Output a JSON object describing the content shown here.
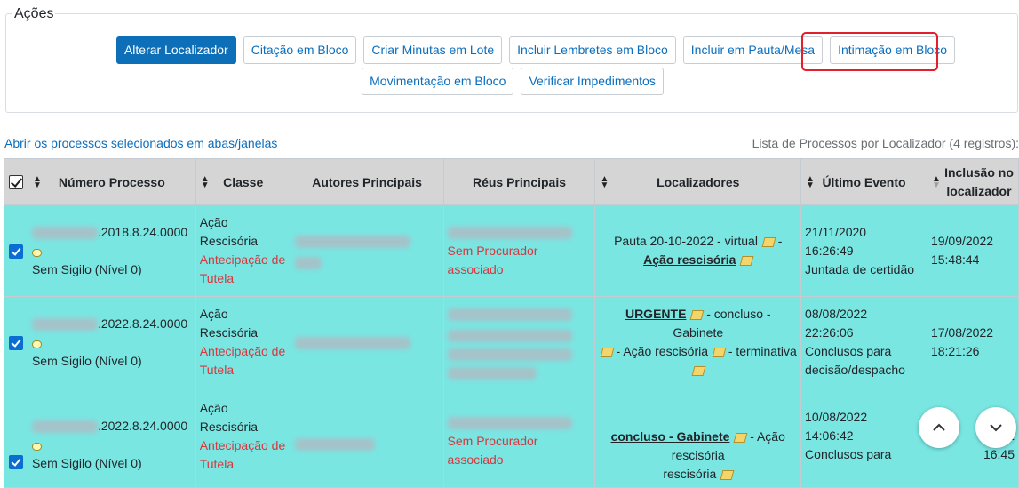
{
  "acoes": {
    "legend": "Ações",
    "buttons_row1": [
      "Alterar Localizador",
      "Citação em Bloco",
      "Criar Minutas em Lote",
      "Incluir Lembretes em Bloco",
      "Incluir em Pauta/Mesa",
      "Intimação em Bloco"
    ],
    "buttons_row2": [
      "Movimentação em Bloco",
      "Verificar Impedimentos"
    ]
  },
  "links": {
    "abrir": "Abrir os processos selecionados em abas/janelas",
    "lista_caption": "Lista de Processos por Localizador (4 registros):"
  },
  "table": {
    "headers": [
      "Número Processo",
      "Classe",
      "Autores Principais",
      "Réus Principais",
      "Localizadores",
      "Último Evento",
      "Inclusão no localizador"
    ],
    "rows": [
      {
        "numero": ".2018.8.24.0000",
        "sigilo": "Sem Sigilo (Nível 0)",
        "classe": "Ação Rescisória",
        "classe_extra": "Antecipação de Tutela",
        "reu_extra": "Sem Procurador associado",
        "loc_prefix": "Pauta 20-10-2022 - virtual",
        "loc_link": "Ação rescisória",
        "evento_data": "21/11/2020",
        "evento_hora": "16:26:49",
        "evento_desc": "Juntada de certidão",
        "inclusao_data": "19/09/2022",
        "inclusao_hora": "15:48:44"
      },
      {
        "numero": ".2022.8.24.0000",
        "sigilo": "Sem Sigilo (Nível 0)",
        "classe": "Ação Rescisória",
        "classe_extra": "Antecipação de Tutela",
        "loc_link": "URGENTE",
        "loc_mid": "- concluso - Gabinete",
        "loc_mid2": "- Ação rescisória",
        "loc_end": "- terminativa",
        "evento_data": "08/08/2022",
        "evento_hora": "22:26:06",
        "evento_desc": "Conclusos para decisão/despacho",
        "inclusao_data": "17/08/2022",
        "inclusao_hora": "18:21:26"
      },
      {
        "numero": ".2022.8.24.0000",
        "sigilo": "Sem Sigilo (Nível 0)",
        "classe": "Ação Rescisória",
        "classe_extra": "Antecipação de Tutela",
        "reu_extra": "Sem Procurador associado",
        "loc_link": "concluso - Gabinete",
        "loc_mid": "- Ação rescisória",
        "evento_data": "10/08/2022",
        "evento_hora": "14:06:42",
        "evento_desc": "Conclusos para",
        "inclusao_data": "/2",
        "inclusao_hora": "16:45"
      }
    ]
  },
  "icons": {
    "scroll_up": "chevron-up-icon",
    "scroll_down": "chevron-down-icon"
  }
}
